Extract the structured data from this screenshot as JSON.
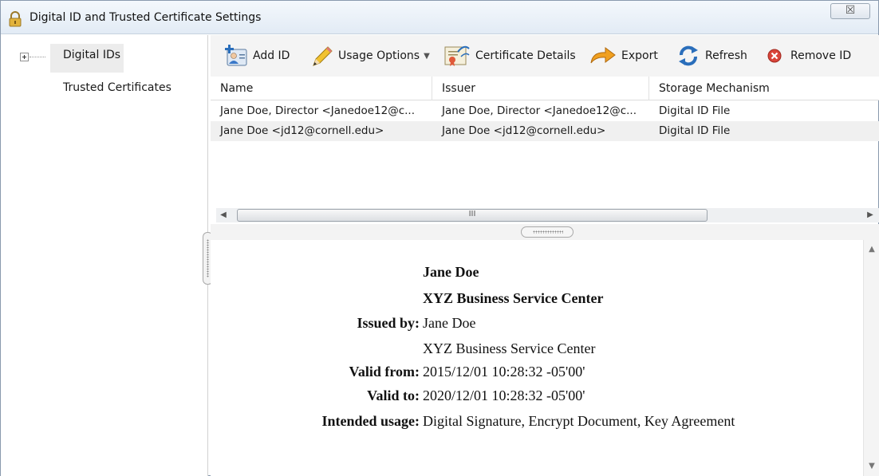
{
  "window": {
    "title": "Digital ID and Trusted Certificate Settings",
    "close_glyph": "☒"
  },
  "nav": {
    "items": [
      {
        "label": "Digital IDs",
        "selected": true
      },
      {
        "label": "Trusted Certificates",
        "selected": false
      }
    ]
  },
  "toolbar": {
    "add_id": "Add ID",
    "usage_options": "Usage Options",
    "certificate_details": "Certificate Details",
    "export": "Export",
    "refresh": "Refresh",
    "remove_id": "Remove ID"
  },
  "table": {
    "columns": [
      "Name",
      "Issuer",
      "Storage Mechanism"
    ],
    "rows": [
      [
        "Jane Doe, Director <Janedoe12@c...",
        "Jane Doe, Director <Janedoe12@c...",
        "Digital ID File"
      ],
      [
        "Jane Doe <jd12@cornell.edu>",
        "Jane Doe <jd12@cornell.edu>",
        "Digital ID File"
      ]
    ]
  },
  "scrollbar": {
    "thumb_glyph": "III"
  },
  "details": {
    "name": "Jane Doe",
    "organization": "XYZ Business Service Center",
    "issued_by_label": "Issued by:",
    "issued_by_name": "Jane Doe",
    "issued_by_org": "XYZ Business Service Center",
    "valid_from_label": "Valid from:",
    "valid_from": "2015/12/01 10:28:32 -05'00'",
    "valid_to_label": "Valid to:",
    "valid_to": "2020/12/01 10:28:32 -05'00'",
    "intended_usage_label": "Intended usage:",
    "intended_usage": "Digital Signature, Encrypt Document, Key Agreement"
  },
  "colors": {
    "accent_blue": "#2a6ebb",
    "export_orange": "#e89a1a",
    "remove_red": "#d9443a"
  }
}
